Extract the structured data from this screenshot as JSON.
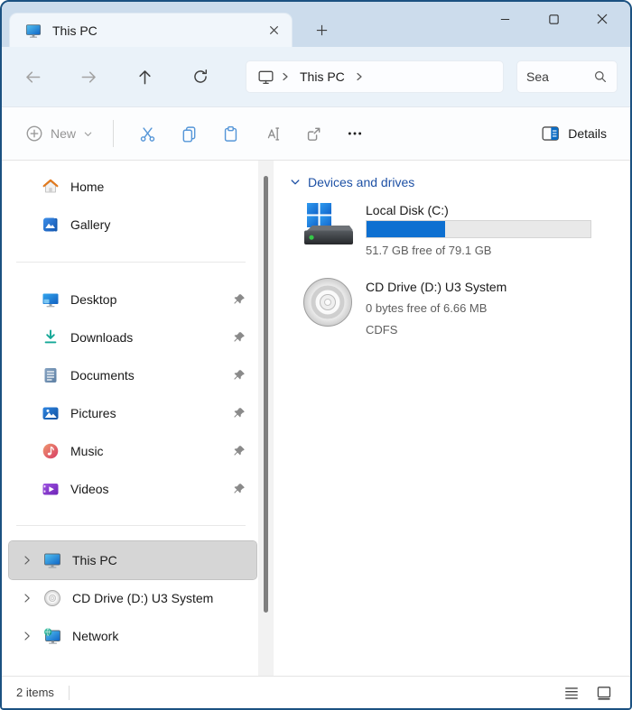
{
  "window": {
    "tab": {
      "title": "This PC"
    }
  },
  "navbar": {
    "breadcrumb": {
      "path": [
        "This PC"
      ]
    },
    "search": {
      "value": "Sea"
    }
  },
  "toolbar": {
    "new_button": {
      "label": "New"
    },
    "details_button": {
      "label": "Details"
    }
  },
  "sidebar": {
    "items": [
      {
        "label": "Home",
        "icon": "home-icon"
      },
      {
        "label": "Gallery",
        "icon": "gallery-icon"
      },
      {
        "label": "Desktop",
        "icon": "desktop-icon",
        "pinned": true
      },
      {
        "label": "Downloads",
        "icon": "downloads-icon",
        "pinned": true
      },
      {
        "label": "Documents",
        "icon": "documents-icon",
        "pinned": true
      },
      {
        "label": "Pictures",
        "icon": "pictures-icon",
        "pinned": true
      },
      {
        "label": "Music",
        "icon": "music-icon",
        "pinned": true
      },
      {
        "label": "Videos",
        "icon": "videos-icon",
        "pinned": true
      },
      {
        "label": "This PC",
        "icon": "computer-icon",
        "expandable": true,
        "selected": true
      },
      {
        "label": "CD Drive (D:) U3 System",
        "icon": "cd-drive-icon",
        "expandable": true
      },
      {
        "label": "Network",
        "icon": "network-icon",
        "expandable": true
      }
    ]
  },
  "main": {
    "group": {
      "header": "Devices and drives",
      "items": [
        {
          "name": "Local Disk (C:)",
          "icon": "hard-drive-icon",
          "free_text": "51.7 GB free of 79.1 GB",
          "capacity_used_percent": 35
        },
        {
          "name": "CD Drive (D:) U3 System",
          "icon": "cd-disc-icon",
          "free_text": "0 bytes free of 6.66 MB",
          "filesystem": "CDFS"
        }
      ]
    }
  },
  "statusbar": {
    "items_count": "2 items"
  },
  "colors": {
    "accent_fill": "#0e70d1",
    "group_header_text": "#1e51a5",
    "titlebar": "#ccdcec",
    "window_border": "#1b5181"
  }
}
